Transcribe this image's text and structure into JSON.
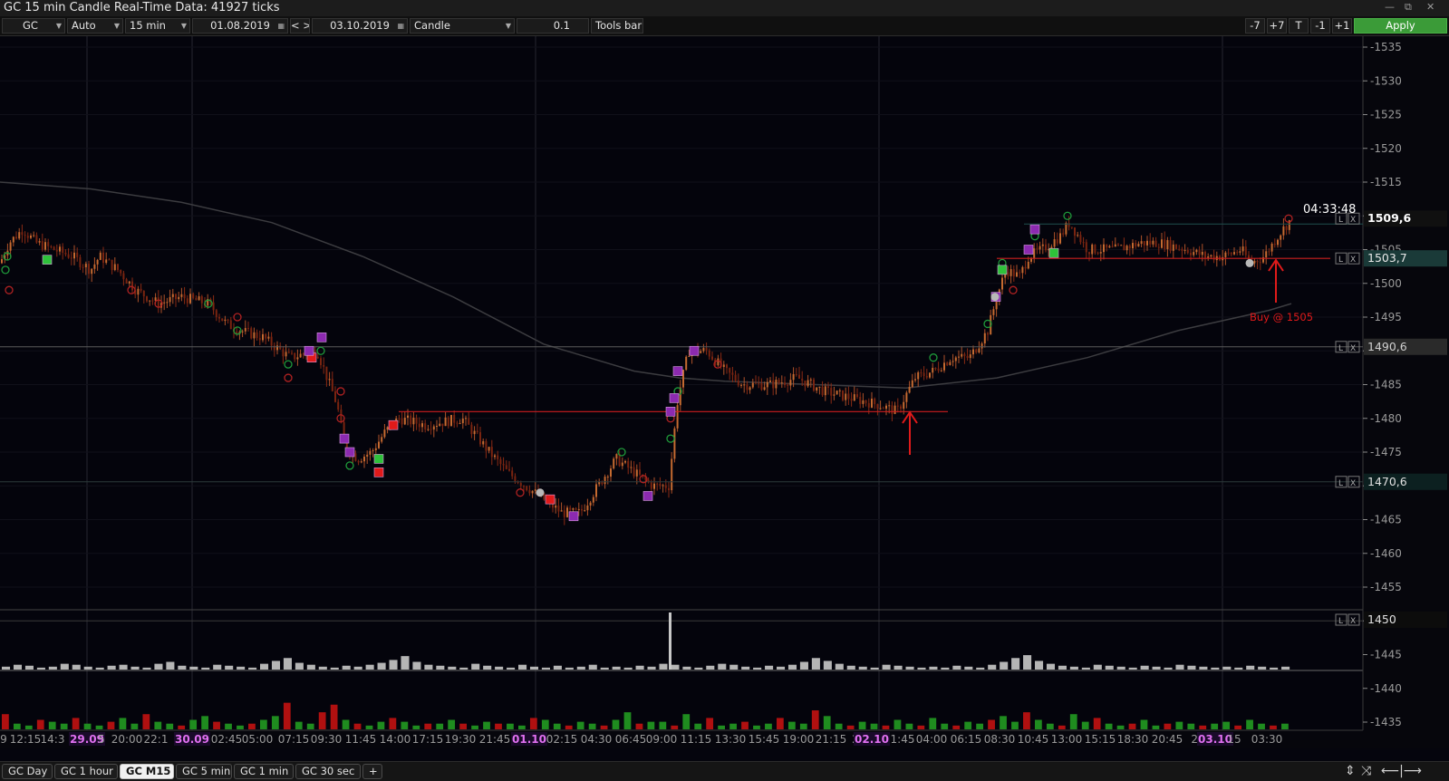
{
  "window": {
    "title": "GC 15 min Candle Real-Time Data: 41927 ticks",
    "btn_min": "—",
    "btn_restore": "⧉",
    "btn_close": "✕"
  },
  "toolbar": {
    "symbol": "GC",
    "scale_mode": "Auto",
    "timeframe": "15 min",
    "date_from": "01.08.2019",
    "nav_prev": "<",
    "nav_next": ">",
    "date_to": "03.10.2019",
    "chart_type": "Candle",
    "tick_size": "0.1",
    "tools_bar": "Tools bar",
    "btn_minus7": "-7",
    "btn_plus7": "+7",
    "btn_t": "T",
    "btn_minus1": "-1",
    "btn_plus1": "+1",
    "apply": "Apply"
  },
  "price_axis": {
    "ticks": [
      "1535",
      "1530",
      "1525",
      "1520",
      "1515",
      "1510",
      "1505",
      "1500",
      "1495",
      "1490",
      "1485",
      "1480",
      "1475",
      "1470",
      "1465",
      "1460",
      "1455",
      "1450",
      "1445",
      "1440",
      "1435"
    ],
    "last_price": "1509,6",
    "countdown": "04:33:48",
    "line_labels": [
      "1503,7",
      "1490,6",
      "1470,6",
      "1450"
    ],
    "line_colors": {
      "last": "#1e4f4c",
      "red": "#cc1e1e",
      "gray": "#5a5a5a"
    }
  },
  "annotations": {
    "buy_text": "Buy @ 1505",
    "line_box_l": "L",
    "line_box_x": "X"
  },
  "time_axis": {
    "labels": [
      "9",
      "12:15",
      "14:3",
      "29.09",
      "5",
      "20:00",
      "22:1",
      "30.09",
      "02:45",
      "05:00",
      "07:15",
      "09:30",
      "11:45",
      "14:00",
      "17:15",
      "19:30",
      "21:45",
      "01.10",
      "02:15",
      "04:30",
      "06:45",
      "09:00",
      "11:15",
      "13:30",
      "15:45",
      "19:00",
      "21:15",
      "2",
      "02.10",
      "1:45",
      "04:00",
      "06:15",
      "08:30",
      "10:45",
      "13:00",
      "15:15",
      "18:30",
      "20:45",
      "23",
      "03.10",
      "15",
      "03:30"
    ],
    "date_labels": [
      "29.09",
      "30.09",
      "01.10",
      "02.10",
      "03.10"
    ]
  },
  "tabs": {
    "items": [
      "GC Day",
      "GC 1 hour",
      "GC M15",
      "GC 5 min",
      "GC 1 min",
      "GC 30 sec",
      "+"
    ],
    "active": "GC M15",
    "icon_expand": "⇕",
    "icon_fit": "⤨",
    "icon_scroll": "⟵|⟶"
  },
  "chart_data": {
    "type": "candlestick",
    "instrument": "GC",
    "timeframe": "15 min",
    "y_range": [
      1432,
      1539
    ],
    "horizontal_lines": [
      1503.7,
      1490.6,
      1470.6,
      1450
    ],
    "support_segments": [
      1481.0,
      1503.7
    ],
    "buy_price": 1505,
    "last_price": 1509.6,
    "price_path": [
      [
        0,
        1503
      ],
      [
        10,
        1506
      ],
      [
        25,
        1508
      ],
      [
        40,
        1506
      ],
      [
        60,
        1505
      ],
      [
        80,
        1504
      ],
      [
        100,
        1502
      ],
      [
        110,
        1504
      ],
      [
        130,
        1502
      ],
      [
        150,
        1499
      ],
      [
        175,
        1497
      ],
      [
        200,
        1498
      ],
      [
        230,
        1497
      ],
      [
        250,
        1494
      ],
      [
        265,
        1493
      ],
      [
        290,
        1492
      ],
      [
        320,
        1489
      ],
      [
        350,
        1490
      ],
      [
        372,
        1482
      ],
      [
        380,
        1476
      ],
      [
        395,
        1474
      ],
      [
        410,
        1475
      ],
      [
        425,
        1478
      ],
      [
        440,
        1480
      ],
      [
        470,
        1479
      ],
      [
        510,
        1480
      ],
      [
        540,
        1475
      ],
      [
        560,
        1472
      ],
      [
        580,
        1470
      ],
      [
        600,
        1468
      ],
      [
        620,
        1466
      ],
      [
        640,
        1466
      ],
      [
        660,
        1470
      ],
      [
        680,
        1474
      ],
      [
        700,
        1472
      ],
      [
        720,
        1470
      ],
      [
        738,
        1470
      ],
      [
        748,
        1483
      ],
      [
        760,
        1490
      ],
      [
        780,
        1490
      ],
      [
        800,
        1487
      ],
      [
        820,
        1485
      ],
      [
        850,
        1485
      ],
      [
        880,
        1486
      ],
      [
        910,
        1484
      ],
      [
        940,
        1483
      ],
      [
        970,
        1482
      ],
      [
        990,
        1481
      ],
      [
        1010,
        1486
      ],
      [
        1030,
        1487
      ],
      [
        1050,
        1489
      ],
      [
        1070,
        1489
      ],
      [
        1090,
        1493
      ],
      [
        1100,
        1498
      ],
      [
        1110,
        1502
      ],
      [
        1125,
        1501
      ],
      [
        1135,
        1504
      ],
      [
        1150,
        1505
      ],
      [
        1170,
        1507
      ],
      [
        1180,
        1509
      ],
      [
        1200,
        1505
      ],
      [
        1230,
        1505
      ],
      [
        1260,
        1506
      ],
      [
        1280,
        1506
      ],
      [
        1310,
        1505
      ],
      [
        1330,
        1504
      ],
      [
        1350,
        1504
      ],
      [
        1370,
        1505
      ],
      [
        1380,
        1503
      ],
      [
        1395,
        1504
      ],
      [
        1410,
        1507
      ],
      [
        1425,
        1509.6
      ]
    ],
    "ma_path": [
      [
        0,
        1515
      ],
      [
        100,
        1514
      ],
      [
        200,
        1512
      ],
      [
        300,
        1509
      ],
      [
        400,
        1504
      ],
      [
        500,
        1498
      ],
      [
        600,
        1491
      ],
      [
        700,
        1487
      ],
      [
        750,
        1486
      ],
      [
        800,
        1485.5
      ],
      [
        900,
        1485
      ],
      [
        1000,
        1484.5
      ],
      [
        1100,
        1486
      ],
      [
        1200,
        1489
      ],
      [
        1300,
        1493
      ],
      [
        1400,
        1496
      ],
      [
        1425,
        1497
      ]
    ],
    "volume_up": [
      3,
      5,
      4,
      2,
      3,
      6,
      5,
      3,
      2,
      4,
      5,
      3,
      2,
      6,
      8,
      4,
      3,
      2,
      5,
      4,
      3,
      2,
      6,
      9,
      12,
      7,
      5,
      3,
      2,
      4,
      3,
      5,
      7,
      10,
      14,
      8,
      5,
      4,
      3,
      2,
      6,
      4,
      3,
      2,
      5,
      3,
      2,
      4,
      2,
      3,
      5,
      2,
      3,
      2,
      4,
      3,
      6,
      5,
      3,
      2,
      4,
      6,
      5,
      3,
      2,
      4,
      3,
      5,
      8,
      12,
      9,
      6,
      4,
      3,
      2,
      5,
      4,
      3,
      2,
      3,
      2,
      4,
      3,
      2,
      5,
      8,
      12,
      15,
      9,
      6,
      4,
      3,
      2,
      5,
      4,
      3,
      2,
      4,
      3,
      2,
      5,
      4,
      3,
      2,
      3,
      2,
      4,
      3,
      2,
      3
    ],
    "volume_down": [
      8,
      3,
      2,
      5,
      4,
      3,
      6,
      3,
      2,
      4,
      6,
      3,
      8,
      4,
      3,
      2,
      5,
      7,
      4,
      3,
      2,
      3,
      5,
      7,
      14,
      4,
      3,
      9,
      13,
      5,
      3,
      2,
      4,
      6,
      4,
      2,
      3,
      3,
      5,
      3,
      2,
      4,
      3,
      3,
      2,
      6,
      5,
      3,
      2,
      4,
      3,
      2,
      5,
      9,
      3,
      4,
      4,
      2,
      8,
      3,
      6,
      2,
      3,
      4,
      2,
      3,
      6,
      4,
      3,
      10,
      7,
      3,
      2,
      4,
      3,
      2,
      5,
      3,
      2,
      6,
      3,
      2,
      4,
      3,
      5,
      7,
      4,
      9,
      5,
      3,
      2,
      8,
      4,
      6,
      3,
      2,
      3,
      5,
      2,
      3,
      4,
      3,
      2,
      3,
      4,
      2,
      5,
      3,
      2,
      3
    ],
    "volume_overlay_max": 33,
    "volume_lower_max": 31
  }
}
